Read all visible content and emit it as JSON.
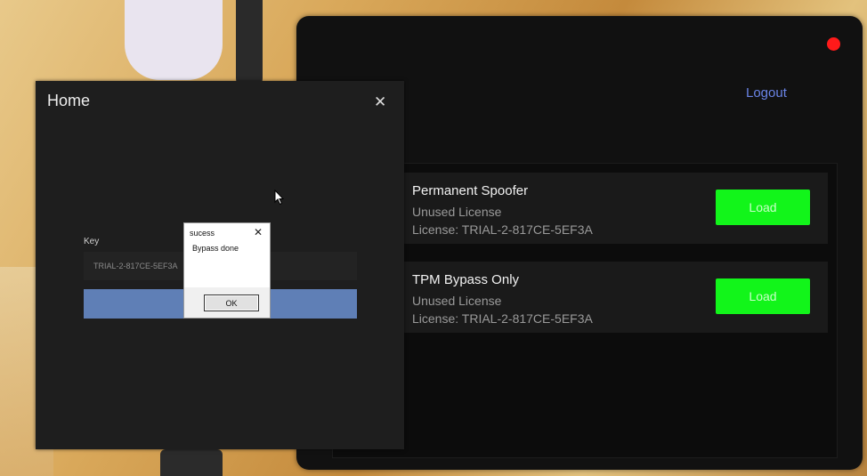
{
  "main_window": {
    "logout_label": "Logout",
    "products": [
      {
        "name": "Permanent Spoofer",
        "status": "Unused License",
        "license": "License: TRIAL-2-817CE-5EF3A",
        "button_label": "Load"
      },
      {
        "name": "TPM Bypass Only",
        "status": "Unused License",
        "license": "License: TRIAL-2-817CE-5EF3A",
        "button_label": "Load"
      }
    ]
  },
  "home_window": {
    "title": "Home",
    "close_symbol": "✕",
    "key_label": "Key",
    "key_value": "TRIAL-2-817CE-5EF3A"
  },
  "message_box": {
    "title": "sucess",
    "close_symbol": "✕",
    "message": "Bypass done",
    "ok_label": "OK"
  },
  "colors": {
    "load_button": "#12f51a",
    "logout_link": "#6a84e6",
    "close_dot": "#ff1a1a",
    "submit_button": "#5f7fb6"
  },
  "icons": {
    "close_dot": "red-circle-close-icon",
    "cursor": "mouse-pointer-icon"
  }
}
